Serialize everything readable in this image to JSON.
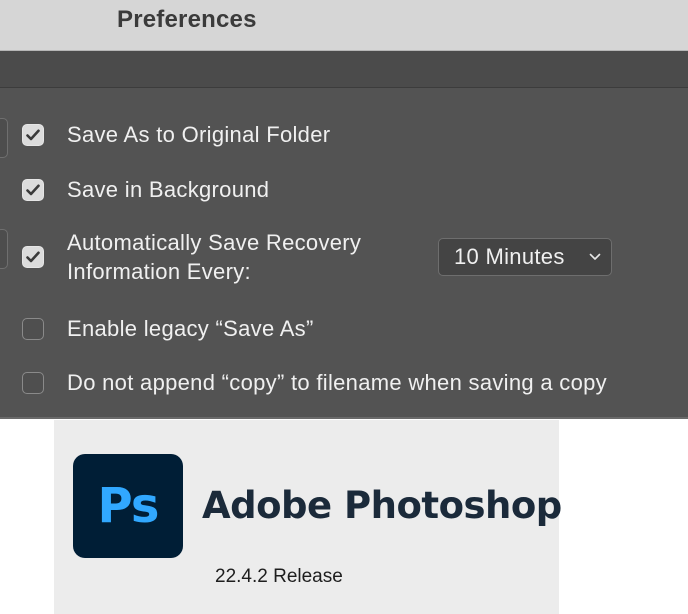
{
  "window": {
    "title": "Preferences"
  },
  "options": [
    {
      "label": "Save As to Original Folder",
      "checked": true
    },
    {
      "label": "Save in Background",
      "checked": true
    },
    {
      "label_line1": "Automatically Save Recovery",
      "label_line2": "Information Every:",
      "checked": true
    },
    {
      "label": "Enable legacy “Save As”",
      "checked": false
    },
    {
      "label": "Do not append “copy” to filename when saving a copy",
      "checked": false
    }
  ],
  "recovery_interval": {
    "selected": "10 Minutes"
  },
  "splash": {
    "logo_letters": "Ps",
    "product_name": "Adobe Photoshop",
    "version": "22.4.2 Release"
  },
  "colors": {
    "panel_bg": "#535353",
    "titlebar_bg": "#d6d6d6",
    "logo_bg": "#001e36",
    "logo_text": "#31a8ff"
  },
  "icons": {
    "checkmark": "checkmark-icon",
    "dropdown": "chevron-down-icon"
  }
}
